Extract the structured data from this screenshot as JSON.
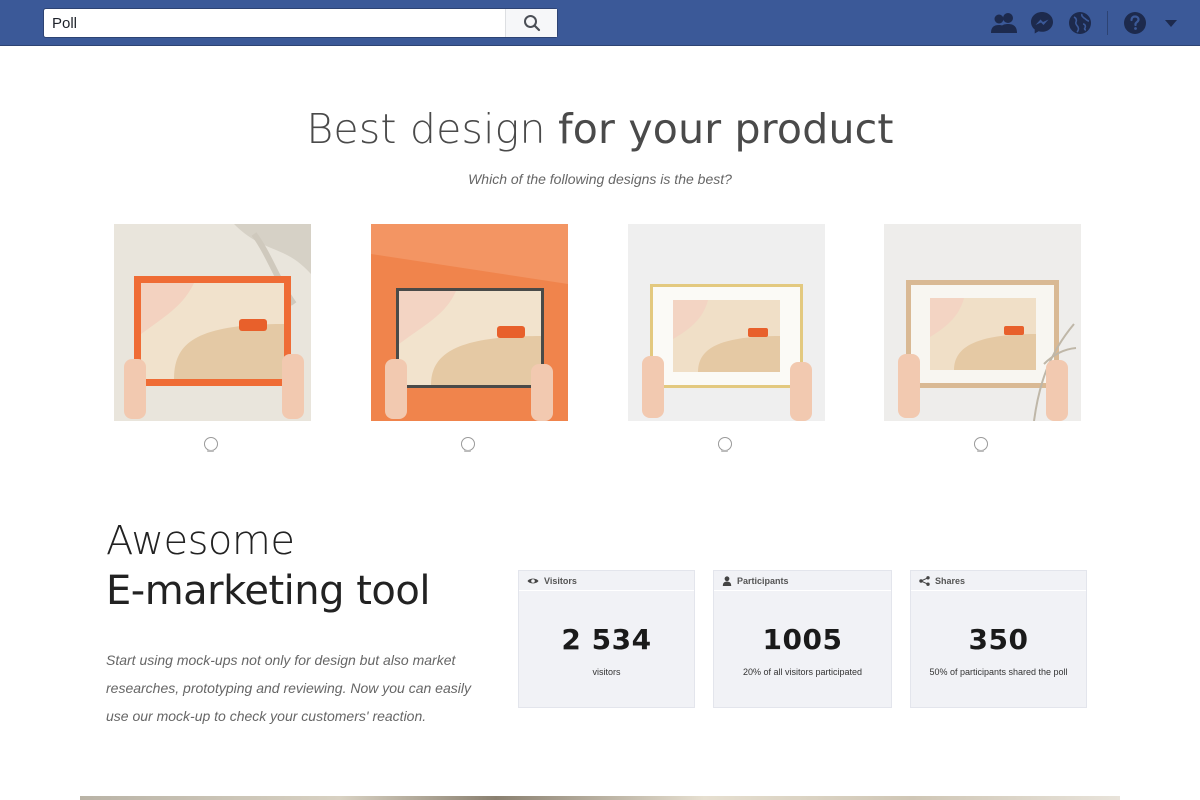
{
  "search": {
    "value": "Poll"
  },
  "nav": {
    "icons": [
      "friends-icon",
      "messenger-icon",
      "globe-icon",
      "help-icon",
      "dropdown-icon"
    ]
  },
  "hero": {
    "title_light": "Best design",
    "title_bold": "for your product",
    "subtitle": "Which of the following designs is the best?"
  },
  "options": [
    {
      "icon": "design-option-1-image",
      "style": "orange frame on beige"
    },
    {
      "icon": "design-option-2-image",
      "style": "black frame on orange"
    },
    {
      "icon": "design-option-3-image",
      "style": "gold frame on white"
    },
    {
      "icon": "design-option-4-image",
      "style": "wood frame on white"
    }
  ],
  "section": {
    "heading_light": "Awesome",
    "heading": "E-marketing tool",
    "description": "Start using mock-ups not only for design but also market researches, prototyping and reviewing. Now you can easily use our mock-up to check your customers' reaction."
  },
  "stats": [
    {
      "label": "Visitors",
      "value": "2 534",
      "caption": "visitors",
      "icon": "eye-icon"
    },
    {
      "label": "Participants",
      "value": "1005",
      "caption": "20% of all visitors participated",
      "icon": "person-icon"
    },
    {
      "label": "Shares",
      "value": "350",
      "caption": "50% of participants shared the poll",
      "icon": "share-icon"
    }
  ],
  "colors": {
    "topbar": "#3b5998",
    "accent": "#ef7a43"
  }
}
